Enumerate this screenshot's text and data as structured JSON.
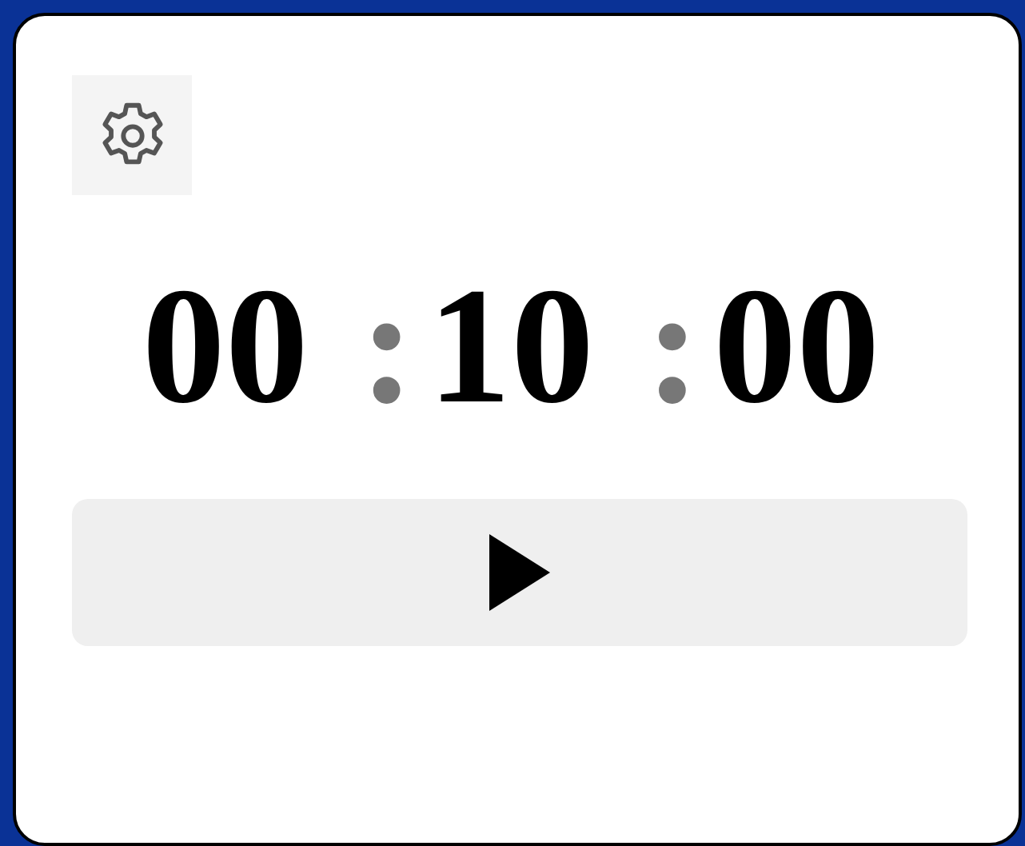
{
  "timer": {
    "segments": [
      {
        "kind": "digits",
        "text": "00"
      },
      {
        "kind": "separator",
        "text": ":"
      },
      {
        "kind": "digits",
        "text": "10"
      },
      {
        "kind": "separator",
        "text": ":"
      },
      {
        "kind": "digits",
        "text": "00"
      }
    ]
  }
}
